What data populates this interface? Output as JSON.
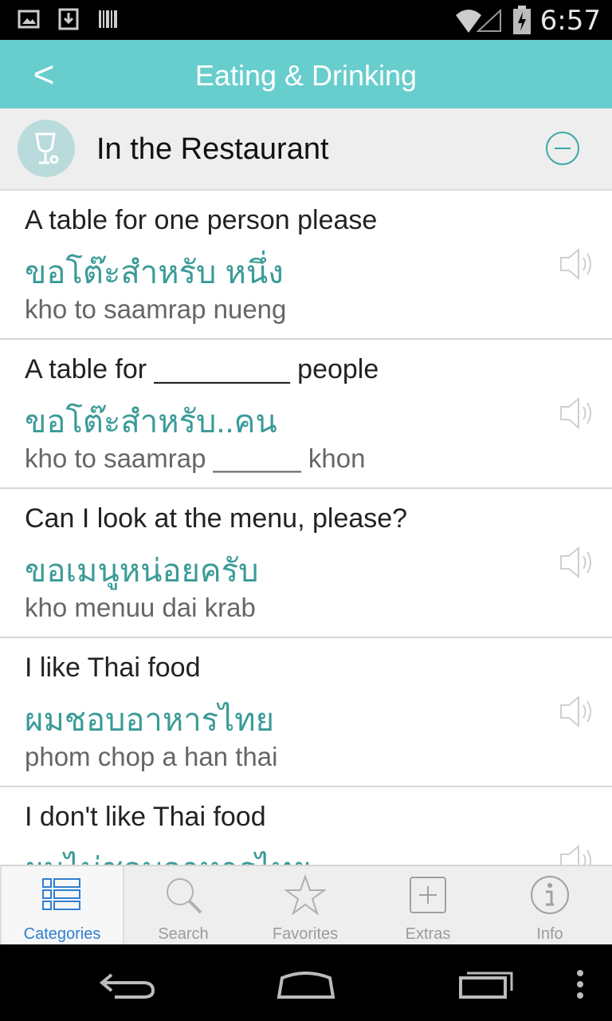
{
  "status_bar": {
    "time": "6:57",
    "icons": [
      "image-icon",
      "download-icon",
      "barcode-icon",
      "wifi-icon",
      "signal-icon",
      "battery-icon"
    ]
  },
  "titlebar": {
    "back_label": "<",
    "title": "Eating & Drinking",
    "color": "#68cdcd"
  },
  "category": {
    "title": "In the Restaurant",
    "icon": "wine-glass-icon",
    "action_icon": "collapse-minus-icon"
  },
  "phrases": [
    {
      "english": "A table for one person please",
      "thai": "ขอโต๊ะสำหรับ หนึ่ง",
      "transliteration": "kho to saamrap nueng"
    },
    {
      "english": "A table for _________ people",
      "thai": "ขอโต๊ะสำหรับ..คน",
      "transliteration": "kho to saamrap ______ khon"
    },
    {
      "english": "Can I look at the menu, please?",
      "thai": "ขอเมนูหน่อยครับ",
      "transliteration": "kho menuu dai krab"
    },
    {
      "english": "I like Thai food",
      "thai": "ผมชอบอาหารไทย",
      "transliteration": "phom chop a han thai"
    },
    {
      "english": "I don't like Thai food",
      "thai": "ผมไม่ชอบอาหารไทย",
      "transliteration": ""
    }
  ],
  "tabs": [
    {
      "label": "Categories",
      "icon": "list-icon",
      "active": true
    },
    {
      "label": "Search",
      "icon": "search-icon",
      "active": false
    },
    {
      "label": "Favorites",
      "icon": "star-icon",
      "active": false
    },
    {
      "label": "Extras",
      "icon": "plus-box-icon",
      "active": false
    },
    {
      "label": "Info",
      "icon": "info-icon",
      "active": false
    }
  ],
  "colors": {
    "accent": "#68cdcd",
    "thai_text": "#3a9b97",
    "active_tab": "#2f7fd1"
  }
}
